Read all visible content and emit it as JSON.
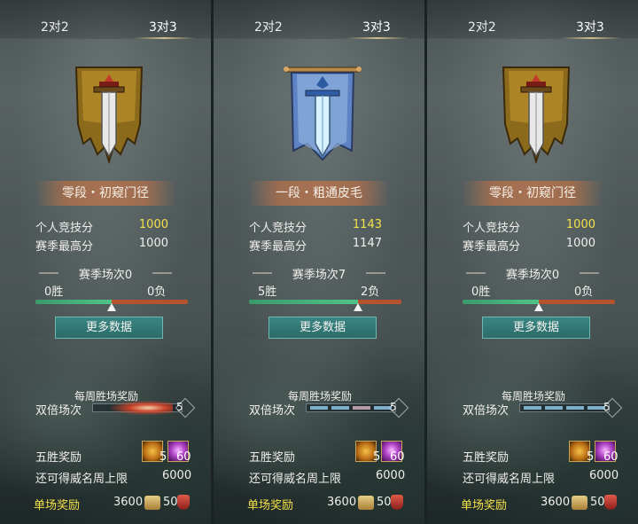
{
  "colors": {
    "highlight_yellow": "#f2e24a",
    "win_green": "#4fc48a",
    "loss_orange": "#b5532e",
    "button_teal": "#2b6c6a"
  },
  "panels": [
    {
      "tabs": [
        "2对2",
        "3对3"
      ],
      "active_tab": 1,
      "emblem": "gold-banner-sword-icon",
      "rank": "零段・初窥门径",
      "personal_score_label": "个人竞技分",
      "personal_score": "1000",
      "season_high_label": "赛季最高分",
      "season_high": "1000",
      "season_matches": "赛季场次0",
      "wins": "0胜",
      "losses": "0负",
      "win_ratio": 0.5,
      "more_button": "更多数据",
      "weekly_title": "每周胜场奖励",
      "double_label": "双倍场次",
      "double_count": "5",
      "double_progress": 0.0,
      "five_win_label": "五胜奖励",
      "item1_count": "5",
      "item2_count": "60",
      "cap_label": "还可得威名周上限",
      "cap_value": "6000",
      "single_label": "单场奖励",
      "single_v1": "3600",
      "single_v2": "50"
    },
    {
      "tabs": [
        "2对2",
        "3对3"
      ],
      "active_tab": 1,
      "emblem": "blue-banner-sword-icon",
      "rank": "一段・粗通皮毛",
      "personal_score_label": "个人竞技分",
      "personal_score": "1143",
      "season_high_label": "赛季最高分",
      "season_high": "1147",
      "season_matches": "赛季场次7",
      "wins": "5胜",
      "losses": "2负",
      "win_ratio": 0.714,
      "more_button": "更多数据",
      "weekly_title": "每周胜场奖励",
      "double_label": "双倍场次",
      "double_count": "5",
      "double_progress": 0.0,
      "five_win_label": "五胜奖励",
      "item1_count": "5",
      "item2_count": "60",
      "cap_label": "还可得威名周上限",
      "cap_value": "6000",
      "single_label": "单场奖励",
      "single_v1": "3600",
      "single_v2": "50"
    },
    {
      "tabs": [
        "2对2",
        "3对3"
      ],
      "active_tab": 1,
      "emblem": "gold-banner-sword-icon",
      "rank": "零段・初窥门径",
      "personal_score_label": "个人竞技分",
      "personal_score": "1000",
      "season_high_label": "赛季最高分",
      "season_high": "1000",
      "season_matches": "赛季场次0",
      "wins": "0胜",
      "losses": "0负",
      "win_ratio": 0.5,
      "more_button": "更多数据",
      "weekly_title": "每周胜场奖励",
      "double_label": "双倍场次",
      "double_count": "5",
      "double_progress": 0.0,
      "five_win_label": "五胜奖励",
      "item1_count": "5",
      "item2_count": "60",
      "cap_label": "还可得威名周上限",
      "cap_value": "6000",
      "single_label": "单场奖励",
      "single_v1": "3600",
      "single_v2": "50"
    }
  ]
}
